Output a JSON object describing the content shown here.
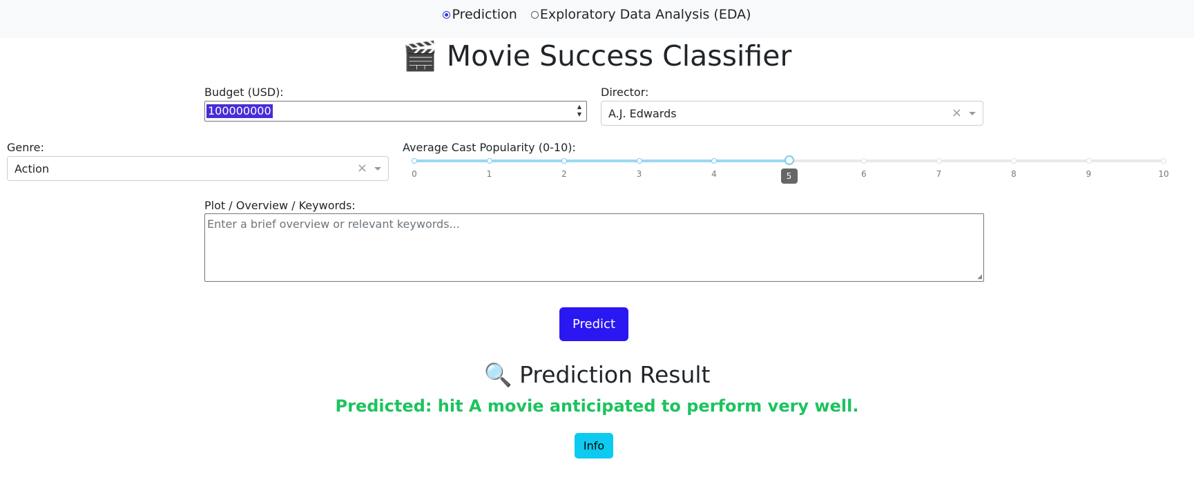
{
  "nav": {
    "options": [
      {
        "label": "Prediction",
        "checked": true
      },
      {
        "label": "Exploratory Data Analysis (EDA)",
        "checked": false
      }
    ]
  },
  "page_title": "🎬 Movie Success Classifier",
  "form": {
    "budget": {
      "label": "Budget (USD):",
      "value": "100000000"
    },
    "director": {
      "label": "Director:",
      "value": "A.J. Edwards"
    },
    "genre": {
      "label": "Genre:",
      "value": "Action"
    },
    "cast_popularity": {
      "label": "Average Cast Popularity (0-10):",
      "value": 5,
      "min": 0,
      "max": 10,
      "ticks": [
        "0",
        "1",
        "2",
        "3",
        "4",
        "5",
        "6",
        "7",
        "8",
        "9",
        "10"
      ]
    },
    "overview": {
      "label": "Plot / Overview / Keywords:",
      "placeholder": "Enter a brief overview or relevant keywords...",
      "value": ""
    }
  },
  "buttons": {
    "predict": "Predict",
    "info": "Info"
  },
  "result": {
    "title": "🔍 Prediction Result",
    "text": "Predicted: hit A movie anticipated to perform very well."
  },
  "colors": {
    "predict_button": "#2a17f2",
    "info_button": "#0dcaf0",
    "result_text": "#1cc35e",
    "slider_fill": "#9bd7f5"
  }
}
